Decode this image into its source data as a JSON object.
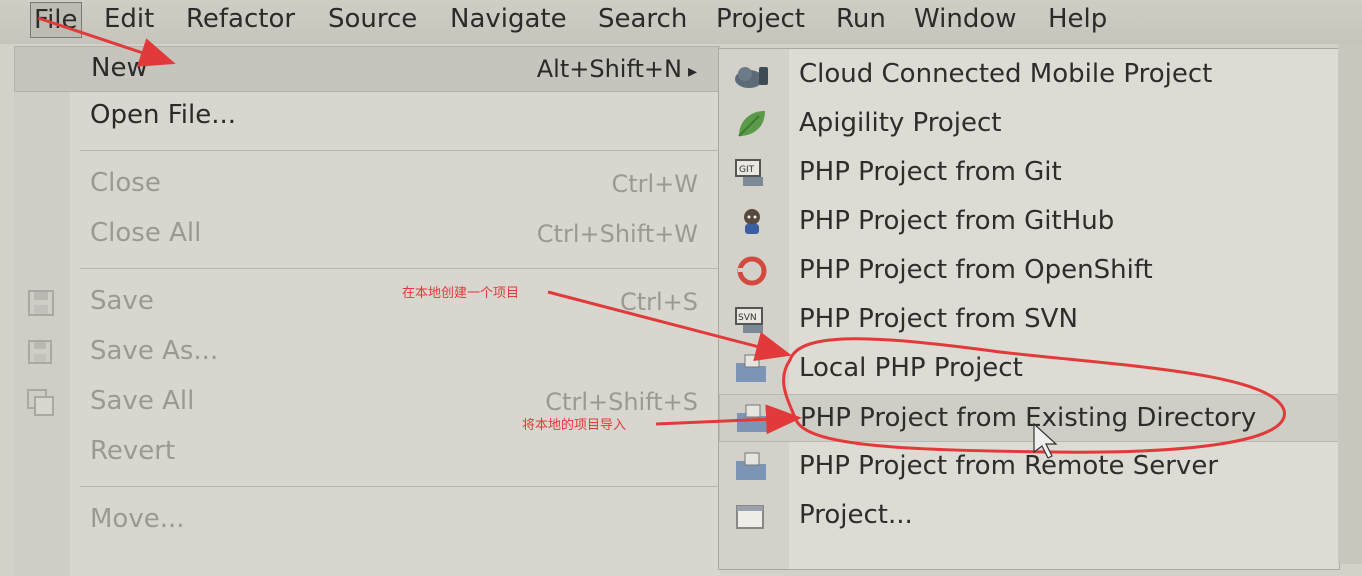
{
  "menubar": {
    "items": [
      "File",
      "Edit",
      "Refactor",
      "Source",
      "Navigate",
      "Search",
      "Project",
      "Run",
      "Window",
      "Help"
    ]
  },
  "file_menu": {
    "items": [
      {
        "label": "New",
        "shortcut": "Alt+Shift+N",
        "submenu_arrow": "▸"
      },
      {
        "label": "Open File..."
      },
      {
        "label": "Close",
        "shortcut": "Ctrl+W"
      },
      {
        "label": "Close All",
        "shortcut": "Ctrl+Shift+W"
      },
      {
        "label": "Save",
        "shortcut": "Ctrl+S"
      },
      {
        "label": "Save As..."
      },
      {
        "label": "Save All",
        "shortcut": "Ctrl+Shift+S"
      },
      {
        "label": "Revert"
      },
      {
        "label": "Move..."
      }
    ]
  },
  "new_submenu": {
    "items": [
      {
        "label": "Cloud Connected Mobile Project",
        "icon": "cloud-mobile-icon"
      },
      {
        "label": "Apigility Project",
        "icon": "leaf-icon"
      },
      {
        "label": "PHP Project from Git",
        "icon": "git-icon"
      },
      {
        "label": "PHP Project from GitHub",
        "icon": "github-icon"
      },
      {
        "label": "PHP Project from OpenShift",
        "icon": "openshift-icon"
      },
      {
        "label": "PHP Project from SVN",
        "icon": "svn-icon"
      },
      {
        "label": "Local PHP Project",
        "icon": "php-folder-icon"
      },
      {
        "label": "PHP Project from Existing Directory",
        "icon": "php-folder-icon"
      },
      {
        "label": "PHP Project from Remote Server",
        "icon": "php-folder-icon"
      },
      {
        "label": "Project...",
        "icon": "project-icon"
      }
    ]
  },
  "annotations": {
    "local_note": "在本地创建一个项目",
    "import_note": "将本地的项目导入"
  },
  "colors": {
    "annotation": "#e23a3a"
  }
}
